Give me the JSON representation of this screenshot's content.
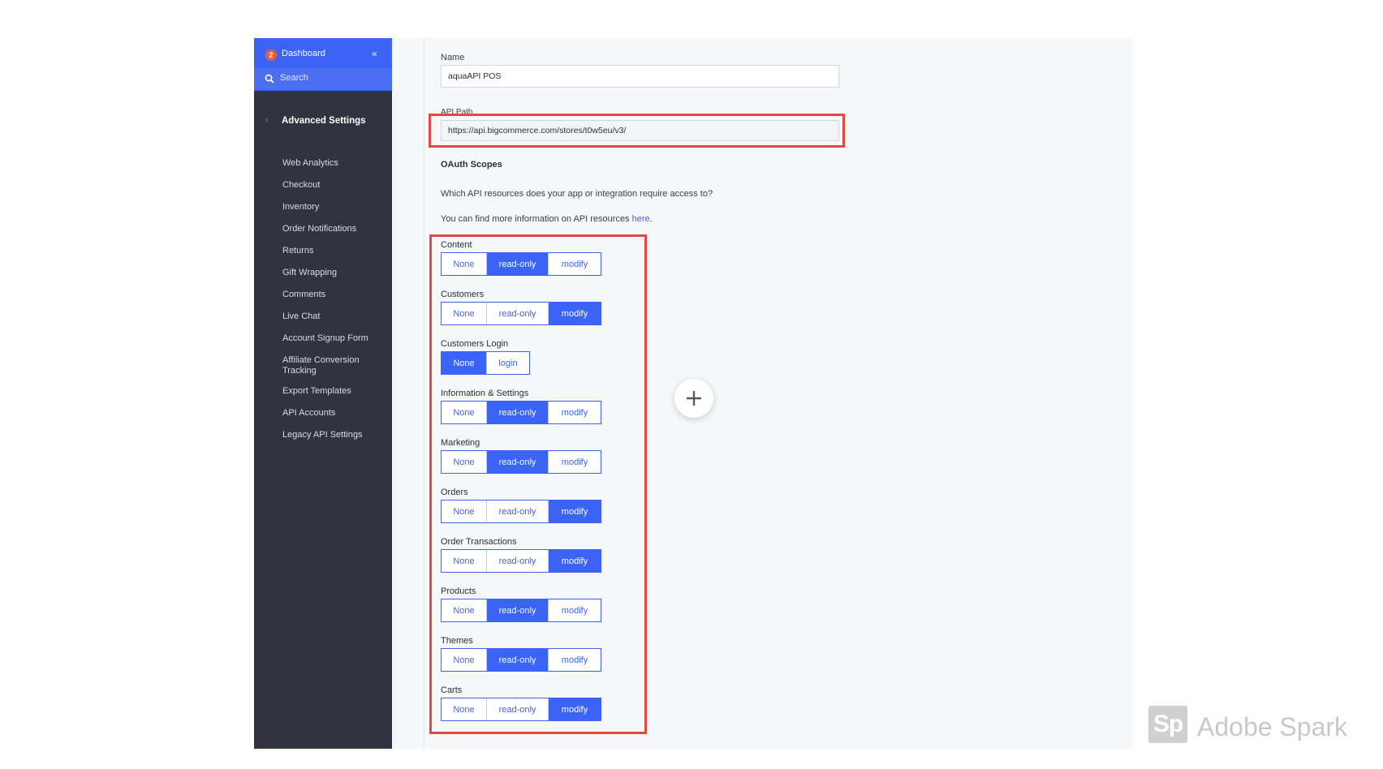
{
  "sidebar": {
    "badge": "2",
    "dashboard_label": "Dashboard",
    "collapse_glyph": "«",
    "search_label": "Search",
    "back_glyph": "‹",
    "section_title": "Advanced Settings",
    "items": [
      {
        "label": "Web Analytics"
      },
      {
        "label": "Checkout"
      },
      {
        "label": "Inventory"
      },
      {
        "label": "Order Notifications"
      },
      {
        "label": "Returns"
      },
      {
        "label": "Gift Wrapping"
      },
      {
        "label": "Comments"
      },
      {
        "label": "Live Chat"
      },
      {
        "label": "Account Signup Form"
      },
      {
        "label": "Affiliate Conversion Tracking"
      },
      {
        "label": "Export Templates"
      },
      {
        "label": "API Accounts"
      },
      {
        "label": "Legacy API Settings"
      }
    ]
  },
  "form": {
    "name_label": "Name",
    "name_value": "aquaAPI POS",
    "api_path_label": "API Path",
    "api_path_value": "https://api.bigcommerce.com/stores/t0w5eu/v3/",
    "oauth_title": "OAuth Scopes",
    "oauth_question": "Which API resources does your app or integration require access to?",
    "oauth_info_prefix": "You can find more information on API resources ",
    "oauth_info_link": "here",
    "oauth_info_suffix": "."
  },
  "scopes": [
    {
      "label": "Content",
      "options": [
        "None",
        "read-only",
        "modify"
      ],
      "selected": "read-only"
    },
    {
      "label": "Customers",
      "options": [
        "None",
        "read-only",
        "modify"
      ],
      "selected": "modify"
    },
    {
      "label": "Customers Login",
      "options": [
        "None",
        "login"
      ],
      "selected": "None"
    },
    {
      "label": "Information & Settings",
      "options": [
        "None",
        "read-only",
        "modify"
      ],
      "selected": "read-only"
    },
    {
      "label": "Marketing",
      "options": [
        "None",
        "read-only",
        "modify"
      ],
      "selected": "read-only"
    },
    {
      "label": "Orders",
      "options": [
        "None",
        "read-only",
        "modify"
      ],
      "selected": "modify"
    },
    {
      "label": "Order Transactions",
      "options": [
        "None",
        "read-only",
        "modify"
      ],
      "selected": "modify"
    },
    {
      "label": "Products",
      "options": [
        "None",
        "read-only",
        "modify"
      ],
      "selected": "read-only"
    },
    {
      "label": "Themes",
      "options": [
        "None",
        "read-only",
        "modify"
      ],
      "selected": "read-only"
    },
    {
      "label": "Carts",
      "options": [
        "None",
        "read-only",
        "modify"
      ],
      "selected": "modify"
    }
  ],
  "watermark": {
    "logo_text": "Sp",
    "text": "Adobe Spark"
  },
  "colors": {
    "sidebar_bg": "#313440",
    "accent": "#3c64f4",
    "highlight": "#e04a43"
  },
  "icons": {
    "search": "search-icon",
    "add": "plus-icon",
    "collapse": "double-chevron-left-icon"
  }
}
